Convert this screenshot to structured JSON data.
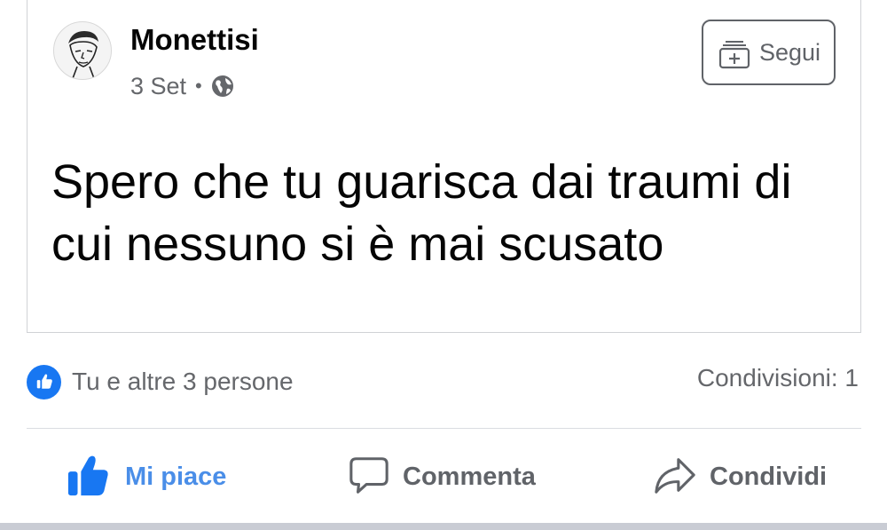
{
  "post": {
    "author": "Monettisi",
    "date": "3 Set",
    "separator": "•",
    "privacy_icon": "globe-icon",
    "follow_label": "Segui",
    "follow_icon": "add-follow-icon",
    "text": "Spero che tu guarisca dai traumi di cui nessuno si è mai scusato"
  },
  "stats": {
    "reactions_text": "Tu e altre 3 persone",
    "reaction_icon": "like-badge-icon",
    "shares_text": "Condivisioni: 1"
  },
  "actions": {
    "like_label": "Mi piace",
    "comment_label": "Commenta",
    "share_label": "Condividi"
  },
  "colors": {
    "accent": "#1877f2",
    "like_active": "#4a8ee8",
    "secondary_text": "#65676b"
  }
}
